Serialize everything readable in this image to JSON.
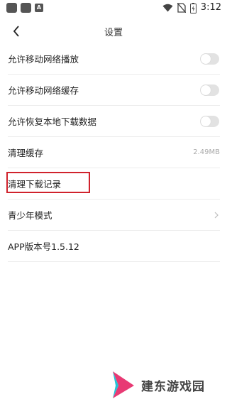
{
  "status_bar": {
    "notification_badge": "A",
    "time": "3:12"
  },
  "nav": {
    "title": "设置"
  },
  "settings": [
    {
      "label": "允许移动网络播放",
      "type": "toggle",
      "on": false
    },
    {
      "label": "允许移动网络缓存",
      "type": "toggle",
      "on": false
    },
    {
      "label": "允许恢复本地下载数据",
      "type": "toggle",
      "on": false
    },
    {
      "label": "清理缓存",
      "type": "value",
      "value": "2.49MB"
    },
    {
      "label": "清理下载记录",
      "type": "action"
    },
    {
      "label": "青少年模式",
      "type": "link"
    },
    {
      "label": "APP版本号1.5.12",
      "type": "info"
    }
  ],
  "highlight_color": "#d0222c",
  "watermark": {
    "text": "建东游戏园"
  }
}
